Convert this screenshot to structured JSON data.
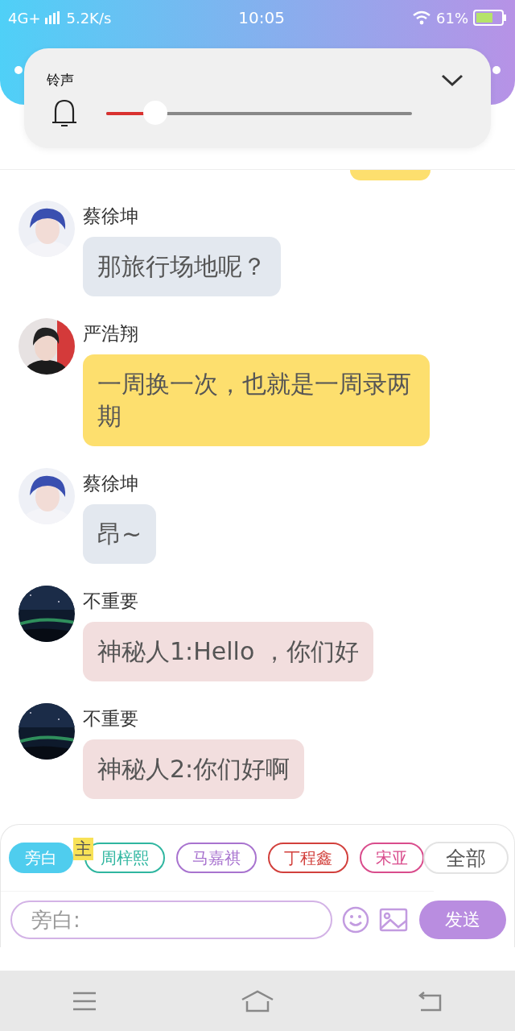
{
  "status_bar": {
    "network": "4G+",
    "speed": "5.2K/s",
    "time": "10:05",
    "battery": "61%"
  },
  "volume_popup": {
    "label": "铃声",
    "level": 0.16
  },
  "partial_bubble": {
    "color": "#fddf6e"
  },
  "messages": [
    {
      "sender": "蔡徐坤",
      "text": "那旅行场地呢？",
      "color": "#e3e8ef",
      "kind": "blue_hair"
    },
    {
      "sender": "严浩翔",
      "text": "一周换一次，也就是一周录两期",
      "color": "#fddf6e",
      "kind": "dark_hair"
    },
    {
      "sender": "蔡徐坤",
      "text": "昂~",
      "color": "#e3e8ef",
      "kind": "blue_hair"
    },
    {
      "sender": "不重要",
      "text": "神秘人1:Hello ，你们好",
      "color": "#f2dede",
      "kind": "night"
    },
    {
      "sender": "不重要",
      "text": "神秘人2:你们好啊",
      "color": "#f2dede",
      "kind": "night"
    }
  ],
  "role_tags": [
    {
      "label": "旁白",
      "color": "#4fcdee",
      "selected": true
    },
    {
      "label": "周梓熙",
      "color": "#2fb6a0",
      "selected": false,
      "badge": "主"
    },
    {
      "label": "马嘉祺",
      "color": "#a873cf",
      "selected": false
    },
    {
      "label": "丁程鑫",
      "color": "#d2403c",
      "selected": false
    },
    {
      "label": "宋亚",
      "color": "#d94c8c",
      "selected": false
    }
  ],
  "all_button": "全部",
  "composer": {
    "placeholder": "旁白:",
    "send": "发送"
  }
}
